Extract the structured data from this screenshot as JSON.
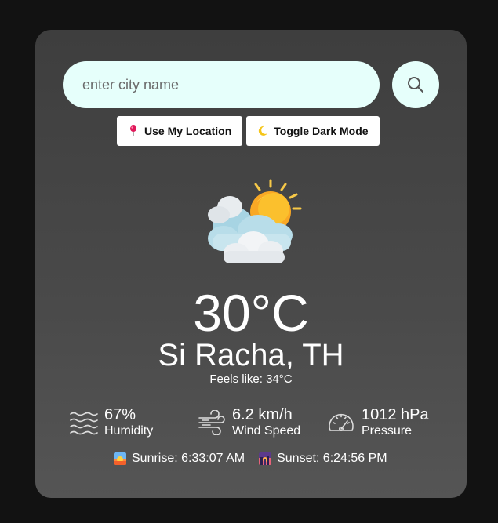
{
  "search": {
    "placeholder": "enter city name",
    "value": ""
  },
  "actions": {
    "location_label": "Use My Location",
    "location_icon": "pin-icon",
    "dark_mode_label": "Toggle Dark Mode",
    "dark_mode_icon": "moon-icon"
  },
  "weather": {
    "icon": "partly-cloudy-sun-icon",
    "temperature": "30°C",
    "city": "Si Racha, TH",
    "feels_like": "Feels like: 34°C"
  },
  "details": {
    "humidity": {
      "value": "67%",
      "label": "Humidity",
      "icon": "waves-icon"
    },
    "wind": {
      "value": "6.2 km/h",
      "label": "Wind Speed",
      "icon": "wind-icon"
    },
    "pressure": {
      "value": "1012 hPa",
      "label": "Pressure",
      "icon": "gauge-icon"
    }
  },
  "sun": {
    "sunrise": "Sunrise: 6:33:07 AM",
    "sunset": "Sunset: 6:24:56 PM"
  },
  "colors": {
    "page_bg": "#121212",
    "card_bg": "#444444",
    "input_bg": "#e6fffb",
    "text": "#ffffff"
  }
}
